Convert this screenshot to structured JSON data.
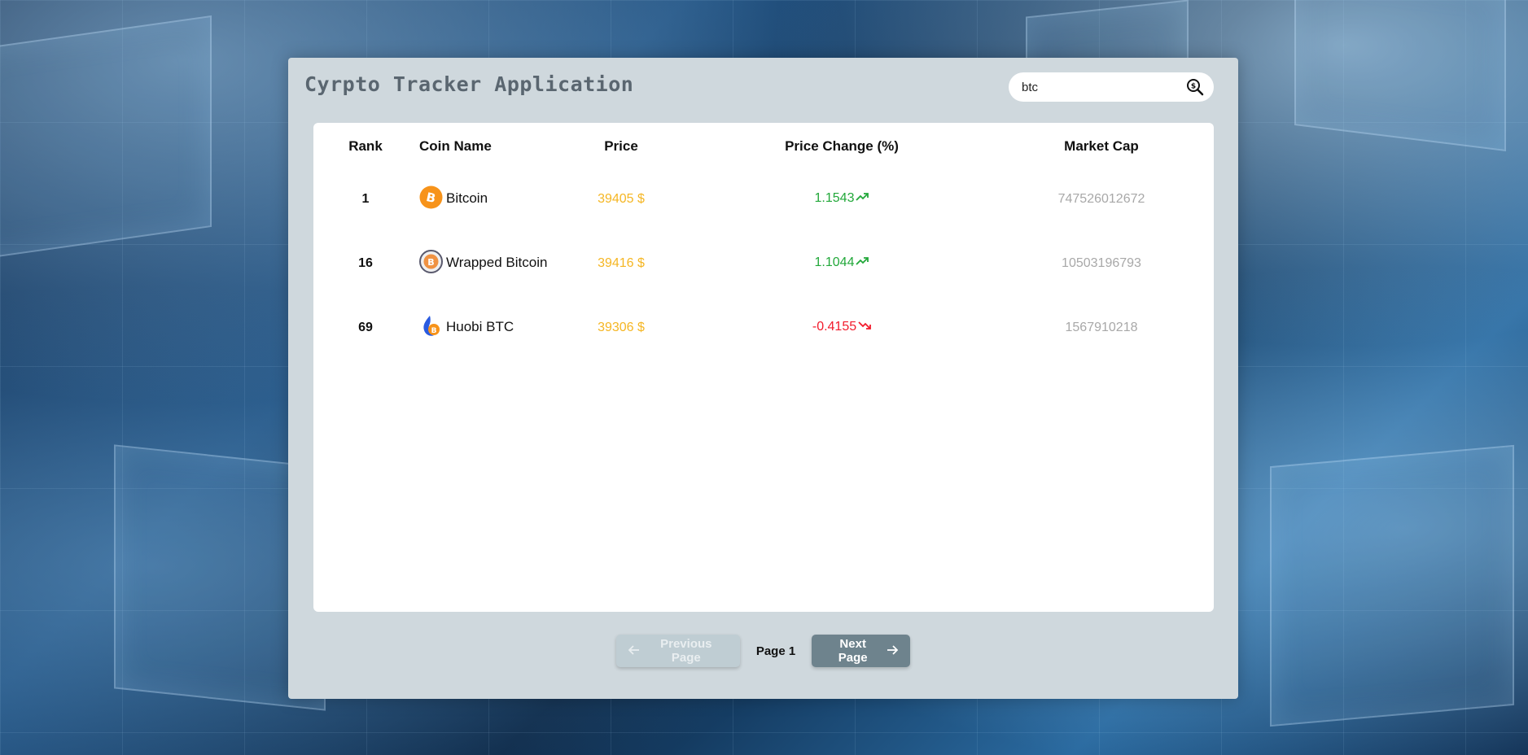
{
  "app": {
    "title": "Cyrpto Tracker Application"
  },
  "search": {
    "value": "btc",
    "icon": "coin-search-icon"
  },
  "table": {
    "headers": {
      "rank": "Rank",
      "name": "Coin Name",
      "price": "Price",
      "change": "Price Change (%)",
      "market_cap": "Market Cap"
    },
    "rows": [
      {
        "rank": "1",
        "name": "Bitcoin",
        "logo": "bitcoin-logo-icon",
        "price": "39405 $",
        "change": "1.1543",
        "direction": "up",
        "market_cap": "747526012672"
      },
      {
        "rank": "16",
        "name": "Wrapped Bitcoin",
        "logo": "wrapped-bitcoin-logo-icon",
        "price": "39416 $",
        "change": "1.1044",
        "direction": "up",
        "market_cap": "10503196793"
      },
      {
        "rank": "69",
        "name": "Huobi BTC",
        "logo": "huobi-btc-logo-icon",
        "price": "39306 $",
        "change": "-0.4155",
        "direction": "down",
        "market_cap": "1567910218"
      }
    ]
  },
  "pagination": {
    "prev_label": "Previous Page",
    "page_label": "Page 1",
    "next_label": "Next Page"
  },
  "colors": {
    "price": "#f5b623",
    "change_up": "#22a83a",
    "change_down": "#f21b2c",
    "market_cap": "#a8a8a8",
    "panel": "#cfd8dd",
    "next_button": "#6e838d",
    "prev_button_disabled": "#bfcdd3"
  }
}
